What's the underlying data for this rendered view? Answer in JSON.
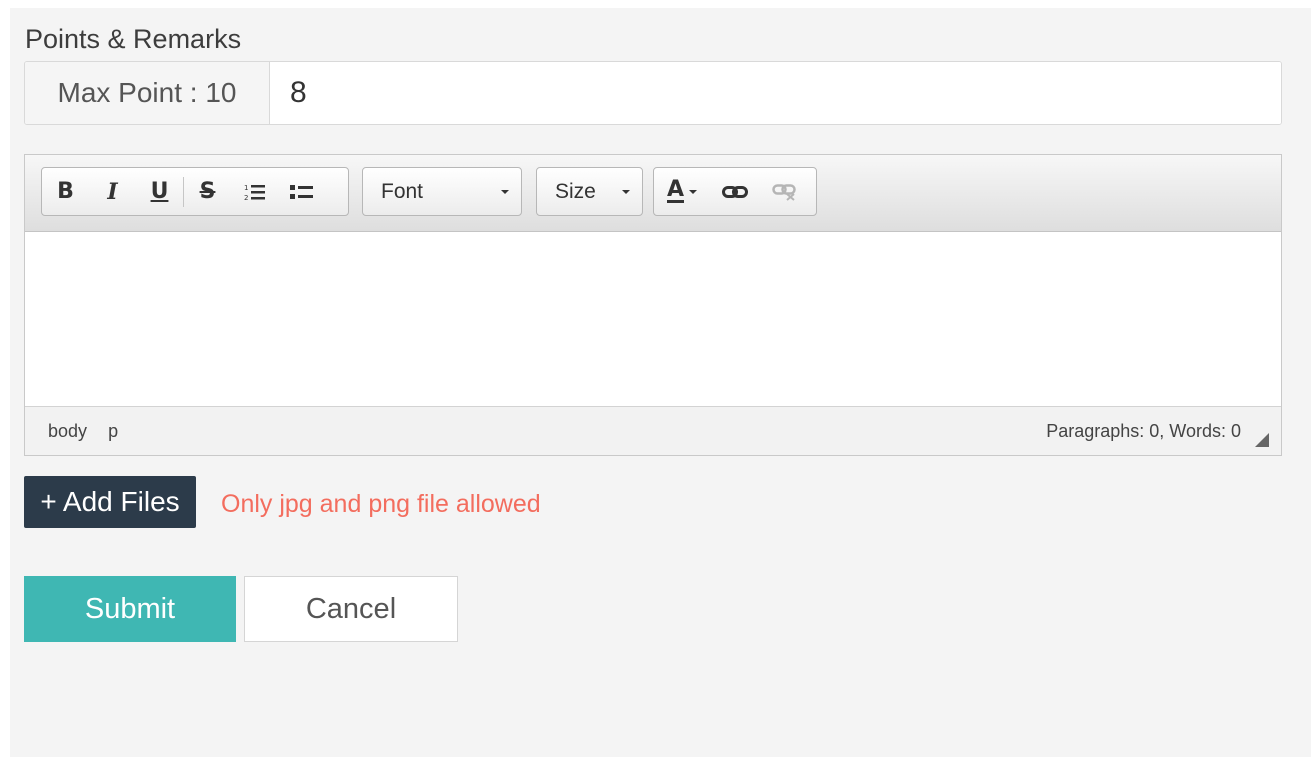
{
  "section": {
    "title": "Points & Remarks"
  },
  "points": {
    "addon_label": "Max Point : 10",
    "value": "8"
  },
  "toolbar": {
    "bold": "B",
    "italic": "I",
    "underline": "U",
    "strike": "S",
    "font_label": "Font",
    "size_label": "Size",
    "color_letter": "A",
    "icons": [
      "bold-icon",
      "italic-icon",
      "underline-icon",
      "strikethrough-icon",
      "ordered-list-icon",
      "unordered-list-icon",
      "text-color-icon",
      "link-icon",
      "unlink-icon"
    ]
  },
  "status": {
    "path": [
      "body",
      "p"
    ],
    "counts": "Paragraphs: 0, Words: 0"
  },
  "upload": {
    "button_label": "+ Add Files",
    "note": "Only jpg and png file allowed"
  },
  "actions": {
    "submit": "Submit",
    "cancel": "Cancel"
  },
  "colors": {
    "submit_bg": "#3fb7b3",
    "add_files_bg": "#2c3b4a",
    "note_text": "#f36d5e",
    "panel_bg": "#f4f4f4"
  }
}
